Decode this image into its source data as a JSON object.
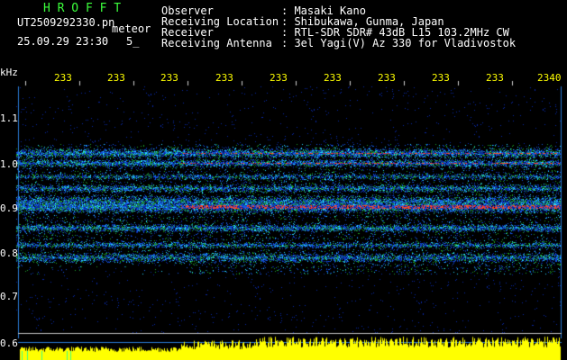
{
  "header": {
    "title": "H R O F F T",
    "file_id": "UT2509292330.pn",
    "mode": "meteor",
    "datetime": "25.09.29 23:30",
    "count": "5_"
  },
  "info": {
    "observer_label": "Observer",
    "observer_value": ": Masaki Kano",
    "location_label": "Receiving Location",
    "location_value": ": Shibukawa, Gunma, Japan",
    "receiver_label": "Receiver",
    "receiver_value": ": RTL-SDR SDR# 43dB L15 103.2MHz CW",
    "antenna_label": "Receiving Antenna",
    "antenna_value": ": 3el Yagi(V) Az 330 for Vladivostok"
  },
  "axis": {
    "y_unit": "kHz",
    "x_ticks": [
      "233",
      "233",
      "233",
      "233",
      "233",
      "233",
      "233",
      "233",
      "233",
      "2340"
    ],
    "y_ticks": [
      "1.1",
      "1.0",
      "0.9",
      "0.8",
      "0.7",
      "0.6"
    ]
  },
  "colors": {
    "background": "#000000",
    "title": "#3cff3c",
    "labels": "#ffffff",
    "ticks": "#ffff00",
    "grid": "#2a7bd6",
    "signal_hot": "#ff2020",
    "meter": "#ffff00"
  }
}
